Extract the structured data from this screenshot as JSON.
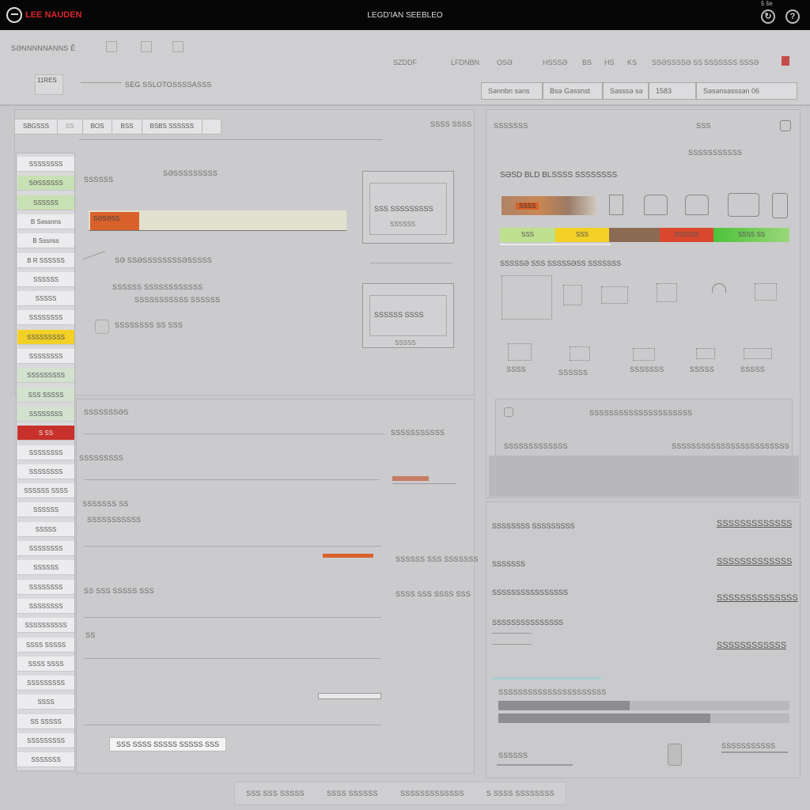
{
  "header": {
    "brand": "LEE NAUDEN",
    "title": "LEGD'IAN SEEBLEO",
    "mini_left": "ŝ ŝe",
    "help_glyph": "?",
    "refresh_glyph": "↻"
  },
  "toolbar": {
    "crumb": "SƏNNNNNANNS Ē",
    "item_a": "11RES",
    "item_b": "SEG SSLOTOSSSSASSS",
    "menu": [
      "SZDDF",
      "LFDNBN",
      "OSƏ",
      "HSSSƏ",
      "BS",
      "HS",
      "KS",
      "SSƏSSSSƏ SS",
      "SSSSSSS SSSƏ"
    ],
    "fields": [
      "Sənnbn səns",
      "Bsə Gəssnst",
      "Səsssə sə",
      "1583",
      "Səsənsəsssən 06"
    ]
  },
  "left_panel": {
    "tabs": [
      "SBGSSS",
      "SS",
      "BOS",
      "BSS",
      "BSBS SSSSSS"
    ],
    "header_label": "SSSS SSSS",
    "row1_label": "SSSSSS",
    "row1_sub": "SƏSSSSSSSSS",
    "orange_label": "SƏSƏSS",
    "caption_a": "SƏ SSƏSSSSSSSSƏSSSSS",
    "caption_b": "SSSSSS SSSSSSSSSSSS",
    "caption_c": "SSSSSSSSSSS SSSSSS",
    "caption_d": "SSSSSSSS SS SSS",
    "box1_title": "SSS SSSSSSSSS",
    "box1_sub": "SSSSSS",
    "box2_title": "SSSSSS SSSS",
    "box2_sub": "SSSSS"
  },
  "left_lower": {
    "title": "SSSSSSSƏS",
    "rows": [
      "SSSSSSSSSSS",
      "SSSSSSSSS",
      "SSSSSSS SS",
      "SSSSSSSSSSS",
      "SSSSSS SSS SSSSSSS",
      "SS SSS SSSSS SSS",
      "SSSS SSS SSSS SSS",
      "SS"
    ],
    "chip": "SSS SSSS   SSSSS SSSSS SSS"
  },
  "side_list": [
    "SSSSSSSS",
    "SƏSSSSSS",
    "SSSSSS",
    "B Səssnns",
    "B Sssnss",
    "B R SSSSSS",
    "SSSSSS",
    "SSSSS",
    "SSSSSSSS",
    "SSSSSSSSS",
    "SSSSSSSS",
    "SSSSSSSSS",
    "SSS SSSSS",
    "SSSSSSSS",
    "S SS",
    "SSSSSSSS",
    "SSSSSSSS",
    "SSSSSS SSSS",
    "SSSSSS",
    "SSSSS",
    "SSSSSSSS",
    "SSSSSS",
    "SSSSSSSS",
    "SSSSSSSS",
    "SSSSSSSSSS",
    "SSSS SSSSS",
    "SSSS SSSS",
    "SSSSSSSSS",
    "SSSS",
    "SS SSSSS",
    "SSSSSSSSS",
    "SSSSSSS"
  ],
  "right_panel": {
    "header": "SSSSSSS",
    "search": "SSS",
    "subtitle": "SSSSSSSSSSS",
    "section_title": "SƏSD BLD BLSSSS SSSSSSSS",
    "orange_chip": "SSSS",
    "score_labels": [
      "SSS",
      "SSS",
      "",
      "SSSSSS",
      "SSSS SS"
    ],
    "section2": "SSSSSƏ SSS SSSSSƏSS SSSSSSS",
    "icon_labels": [
      "SSSS",
      "SSSSSS",
      "SSSSSSS",
      "SSSSS",
      "SSSSS"
    ],
    "note_title": "SSSSSSSSSSSSSSSSSSSSS",
    "note_left": "SSSSSSSSSSSSS",
    "note_right": "SSSSSSSSSSSSSSSSSSSSSSSS"
  },
  "right_lower": {
    "rows": [
      {
        "left": "SSSSSSSS SSSSSSSSS",
        "right": "SSSSSSSSSSSSS"
      },
      {
        "left": "SSSSSSS",
        "right": "SSSSSSSSSSSSS"
      },
      {
        "left": "SSSSSSSSSSSSSSSS",
        "right": "SSSSSSSSSSSSSS"
      },
      {
        "left": "SSSSSSSSSSSSSSS",
        "right": "SSSSSSSSSSSS"
      }
    ],
    "bar_label": "SSSSSSSSSSSSSSSSSSSSSS",
    "footer_left": "SSSSSS",
    "footer_right": "SSSSSSSSSSS"
  },
  "footer": {
    "buttons": [
      "SSS SSS SSSSS",
      "SSSS SSSSSS",
      "SSSSSSSSSSSSS",
      "S SSSS SSSSSSSS"
    ]
  },
  "colors": {
    "topbar": "#060606",
    "brand": "#d8262b",
    "orange": "#d9612b",
    "yellow": "#f2d026",
    "green": "#5ec83d",
    "red": "#c8312b",
    "brown": "#8b6b54",
    "light_green": "#c7e0b4"
  }
}
